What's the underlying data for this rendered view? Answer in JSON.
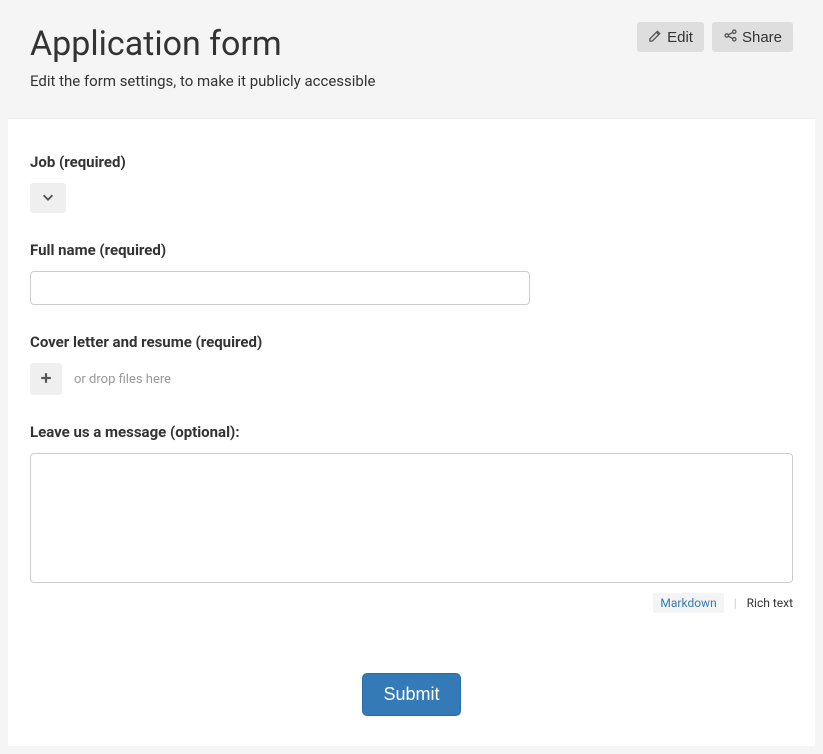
{
  "header": {
    "title": "Application form",
    "subtitle": "Edit the form settings, to make it publicly accessible",
    "edit_btn": "Edit",
    "share_btn": "Share"
  },
  "form": {
    "job": {
      "label": "Job (required)"
    },
    "full_name": {
      "label": "Full name (required)",
      "value": ""
    },
    "cover": {
      "label": "Cover letter and resume (required)",
      "hint": "or drop files here"
    },
    "message": {
      "label": "Leave us a message (optional):",
      "value": "",
      "markdown": "Markdown",
      "richtext": "Rich text"
    },
    "submit": "Submit"
  }
}
